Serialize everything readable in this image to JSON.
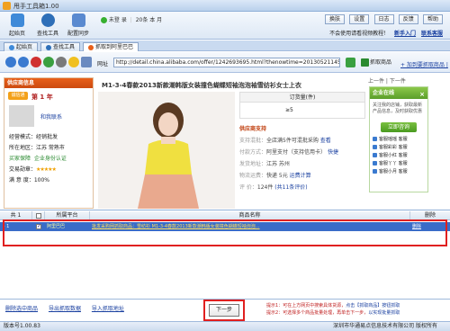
{
  "app": {
    "title": "甩手工具箱1.00"
  },
  "toolbar": {
    "buttons": [
      {
        "label": "起始页",
        "name": "home",
        "color": "#3f8ad8"
      },
      {
        "label": "查找工具",
        "name": "find-tool",
        "color": "#2e6fb8"
      },
      {
        "label": "配置同步",
        "name": "sync",
        "color": "#5a8ad0"
      }
    ],
    "status_user": "未登 录",
    "status_extra": "20条 本 月",
    "right_buttons": [
      "换肤",
      "设置",
      "日志",
      "反馈",
      "帮助"
    ],
    "notice": "不会使用请看视频教程！",
    "notice_link": "新手入门",
    "notice_link2": "联系客服"
  },
  "tabs": [
    {
      "label": "起始页",
      "active": false
    },
    {
      "label": "查找工具",
      "active": false
    },
    {
      "label": "抓取到阿里巴巴",
      "active": true
    }
  ],
  "address": {
    "label": "网址",
    "url": "http://detail.china.alibaba.com/offer/1242693695.html?thenowtime=201305211450",
    "grab_label": "抓取商品",
    "add_link": "+ 加到要抓取商品 |"
  },
  "supplier": {
    "heading": "供应商信息",
    "badge": "诚信通",
    "years": "第 1 年",
    "contact": "和我联系",
    "mode": "经营模式：经销批发",
    "location": "所在地区：江苏 常熟市",
    "trust": "买家保障",
    "assess": "企业身份认证",
    "rating_label": "交易勋章：",
    "rating": "★★★★★",
    "reply_label": "满 意 度：",
    "reply_rate": "100%"
  },
  "product": {
    "title": "M1-3-4春款2013新款潮韩版女装撞色蝴蝶短袖泡泡袖雪纺衫女士上衣",
    "order_head": "订货量(件)",
    "order_val": "≥5",
    "support_title": "供应商支持",
    "rows": [
      {
        "label": "支持混批：",
        "value": "全店满5件可混批采购",
        "link": "查看"
      },
      {
        "label": "付款方式：",
        "value": "阿里支付（支持信用卡）",
        "link": "快捷"
      },
      {
        "label": "发货地址：",
        "value": "江苏 苏州",
        "link": ""
      },
      {
        "label": "物流运费：",
        "value": "快递 5元",
        "link": "运费计算"
      },
      {
        "label": "评 价：",
        "value": "124件",
        "link": "(共11条评价)"
      }
    ],
    "nav_prev": "上一件",
    "nav_next": "下一件"
  },
  "enterprise": {
    "heading": "企业在线",
    "text": "关注我的店铺，获取最新产品信息，及时获取优惠",
    "button": "立即咨询",
    "items": [
      "客服瑶瑶",
      "客服彩彩",
      "客服小红",
      "客服丫丫",
      "客服小月"
    ],
    "item_status": "客服"
  },
  "grid": {
    "headers": [
      "共 1",
      "",
      "所属平台",
      "商品名称",
      "删除"
    ],
    "rows": [
      {
        "index": "1",
        "platform": "阿里巴巴",
        "name": "批发采购网抓取商品：雪纺衫 M1-3-4春款2013新款潮韩版女装撞色蝴蝶短袖泡泡...",
        "delete": "删除"
      }
    ]
  },
  "footer": {
    "links": [
      "删除选中商品",
      "导出抓取数据",
      "导入抓取地址"
    ],
    "next_button": "下一步",
    "tip1": "提示1：可在上方网页中搜索具体货源，",
    "tip1b": "点击【抓取商品】按钮抓取",
    "tip2": "提示2：可选择多个商品批量处理，再单击下一步，",
    "tip2b": "以实现批量抓取"
  },
  "statusbar": {
    "version": "版本号1.00.83",
    "copyright": "深圳市华通易点信息技术有限公司 版权所有"
  }
}
